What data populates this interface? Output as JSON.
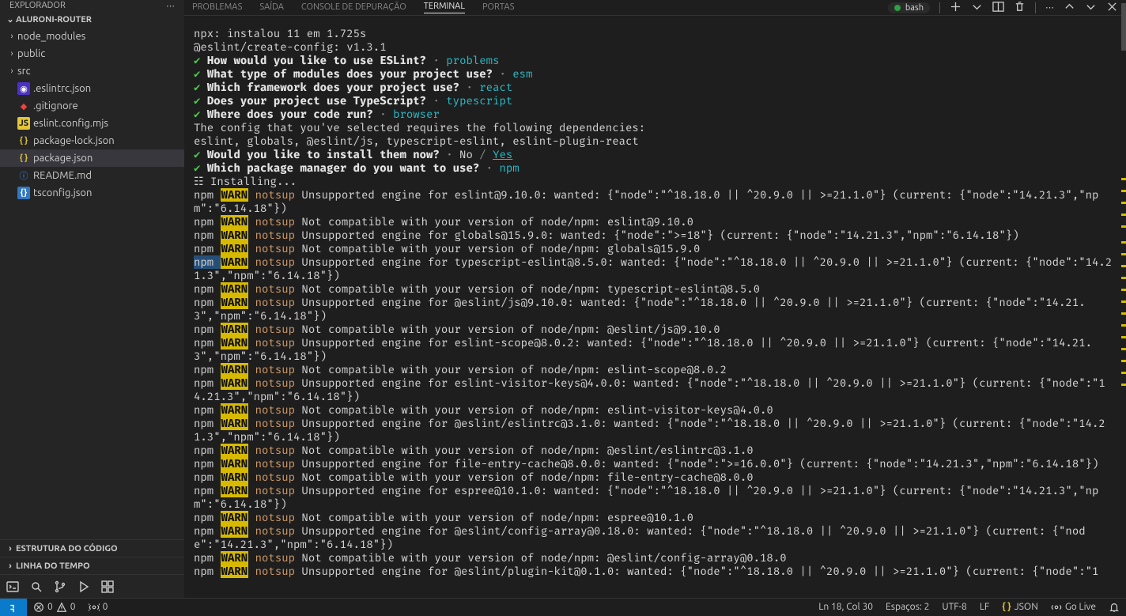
{
  "explorer": {
    "title": "EXPLORADOR",
    "project": "ALURONI-ROUTER",
    "folders": [
      {
        "label": "node_modules"
      },
      {
        "label": "public"
      },
      {
        "label": "src"
      }
    ],
    "files": [
      {
        "label": ".eslintrc.json",
        "icon": "eslint"
      },
      {
        "label": ".gitignore",
        "icon": "git"
      },
      {
        "label": "eslint.config.mjs",
        "icon": "js"
      },
      {
        "label": "package-lock.json",
        "icon": "braces-y"
      },
      {
        "label": "package.json",
        "icon": "braces-y",
        "active": true
      },
      {
        "label": "README.md",
        "icon": "info"
      },
      {
        "label": "tsconfig.json",
        "icon": "ts"
      }
    ],
    "outline": "ESTRUTURA DO CÓDIGO",
    "timeline": "LINHA DO TEMPO"
  },
  "panel": {
    "tabs": {
      "problems": "PROBLEMAS",
      "output": "SAÍDA",
      "debugconsole": "CONSOLE DE DEPURAÇÃO",
      "terminal": "TERMINAL",
      "ports": "PORTAS"
    },
    "shell": "bash"
  },
  "terminal_lines": [
    {
      "t": "plain",
      "text": ""
    },
    {
      "t": "plain",
      "text": "npx: instalou 11 em 1.725s"
    },
    {
      "t": "plain",
      "text": "@eslint/create-config: v1.3.1"
    },
    {
      "t": "plain",
      "text": ""
    },
    {
      "t": "q",
      "q": "How would you like to use ESLint?",
      "a": "problems"
    },
    {
      "t": "q",
      "q": "What type of modules does your project use?",
      "a": "esm"
    },
    {
      "t": "q",
      "q": "Which framework does your project use?",
      "a": "react"
    },
    {
      "t": "q",
      "q": "Does your project use TypeScript?",
      "a": "typescript"
    },
    {
      "t": "q",
      "q": "Where does your code run?",
      "a": "browser"
    },
    {
      "t": "plain",
      "text": "The config that you've selected requires the following dependencies:"
    },
    {
      "t": "plain",
      "text": ""
    },
    {
      "t": "plain",
      "text": "eslint, globals, @eslint/js, typescript-eslint, eslint-plugin-react"
    },
    {
      "t": "qyn",
      "q": "Would you like to install them now?",
      "no": "No",
      "yes": "Yes"
    },
    {
      "t": "q",
      "q": "Which package manager do you want to use?",
      "a": "npm"
    },
    {
      "t": "installing",
      "text": "Installing..."
    },
    {
      "t": "warn",
      "text": "Unsupported engine for eslint@9.10.0: wanted: {\"node\":\"^18.18.0 || ^20.9.0 || >=21.1.0\"} (current: {\"node\":\"14.21.3\",\"npm\":\"6.14.18\"})"
    },
    {
      "t": "warn",
      "text": "Not compatible with your version of node/npm: eslint@9.10.0"
    },
    {
      "t": "warn",
      "text": "Unsupported engine for globals@15.9.0: wanted: {\"node\":\">=18\"} (current: {\"node\":\"14.21.3\",\"npm\":\"6.14.18\"})"
    },
    {
      "t": "warn",
      "text": "Not compatible with your version of node/npm: globals@15.9.0"
    },
    {
      "t": "warn",
      "text": "Unsupported engine for typescript-eslint@8.5.0: wanted: {\"node\":\"^18.18.0 || ^20.9.0 || >=21.1.0\"} (current: {\"node\":\"14.21.3\",\"npm\":\"6.14.18\"})",
      "sel": true
    },
    {
      "t": "warn",
      "text": "Not compatible with your version of node/npm: typescript-eslint@8.5.0"
    },
    {
      "t": "warn",
      "text": "Unsupported engine for @eslint/js@9.10.0: wanted: {\"node\":\"^18.18.0 || ^20.9.0 || >=21.1.0\"} (current: {\"node\":\"14.21.3\",\"npm\":\"6.14.18\"})"
    },
    {
      "t": "warn",
      "text": "Not compatible with your version of node/npm: @eslint/js@9.10.0"
    },
    {
      "t": "warn",
      "text": "Unsupported engine for eslint-scope@8.0.2: wanted: {\"node\":\"^18.18.0 || ^20.9.0 || >=21.1.0\"} (current: {\"node\":\"14.21.3\",\"npm\":\"6.14.18\"})"
    },
    {
      "t": "warn",
      "text": "Not compatible with your version of node/npm: eslint-scope@8.0.2"
    },
    {
      "t": "warn",
      "text": "Unsupported engine for eslint-visitor-keys@4.0.0: wanted: {\"node\":\"^18.18.0 || ^20.9.0 || >=21.1.0\"} (current: {\"node\":\"14.21.3\",\"npm\":\"6.14.18\"})"
    },
    {
      "t": "warn",
      "text": "Not compatible with your version of node/npm: eslint-visitor-keys@4.0.0"
    },
    {
      "t": "warn",
      "text": "Unsupported engine for @eslint/eslintrc@3.1.0: wanted: {\"node\":\"^18.18.0 || ^20.9.0 || >=21.1.0\"} (current: {\"node\":\"14.21.3\",\"npm\":\"6.14.18\"})"
    },
    {
      "t": "warn",
      "text": "Not compatible with your version of node/npm: @eslint/eslintrc@3.1.0"
    },
    {
      "t": "warn",
      "text": "Unsupported engine for file-entry-cache@8.0.0: wanted: {\"node\":\">=16.0.0\"} (current: {\"node\":\"14.21.3\",\"npm\":\"6.14.18\"})"
    },
    {
      "t": "warn",
      "text": "Not compatible with your version of node/npm: file-entry-cache@8.0.0"
    },
    {
      "t": "warn",
      "text": "Unsupported engine for espree@10.1.0: wanted: {\"node\":\"^18.18.0 || ^20.9.0 || >=21.1.0\"} (current: {\"node\":\"14.21.3\",\"npm\":\"6.14.18\"})"
    },
    {
      "t": "warn",
      "text": "Not compatible with your version of node/npm: espree@10.1.0"
    },
    {
      "t": "warn",
      "text": "Unsupported engine for @eslint/config-array@0.18.0: wanted: {\"node\":\"^18.18.0 || ^20.9.0 || >=21.1.0\"} (current: {\"node\":\"14.21.3\",\"npm\":\"6.14.18\"})"
    },
    {
      "t": "warn",
      "text": "Not compatible with your version of node/npm: @eslint/config-array@0.18.0"
    },
    {
      "t": "warn",
      "text": "Unsupported engine for @eslint/plugin-kit@0.1.0: wanted: {\"node\":\"^18.18.0 || ^20.9.0 || >=21.1.0\"} (current: {\"node\":\"1"
    }
  ],
  "statusbar": {
    "errors": "0",
    "warnings": "0",
    "ports": "0",
    "lncol": "Ln 18, Col 30",
    "spaces": "Espaços: 2",
    "encoding": "UTF-8",
    "eol": "LF",
    "lang": "JSON",
    "golive": "Go Live"
  }
}
